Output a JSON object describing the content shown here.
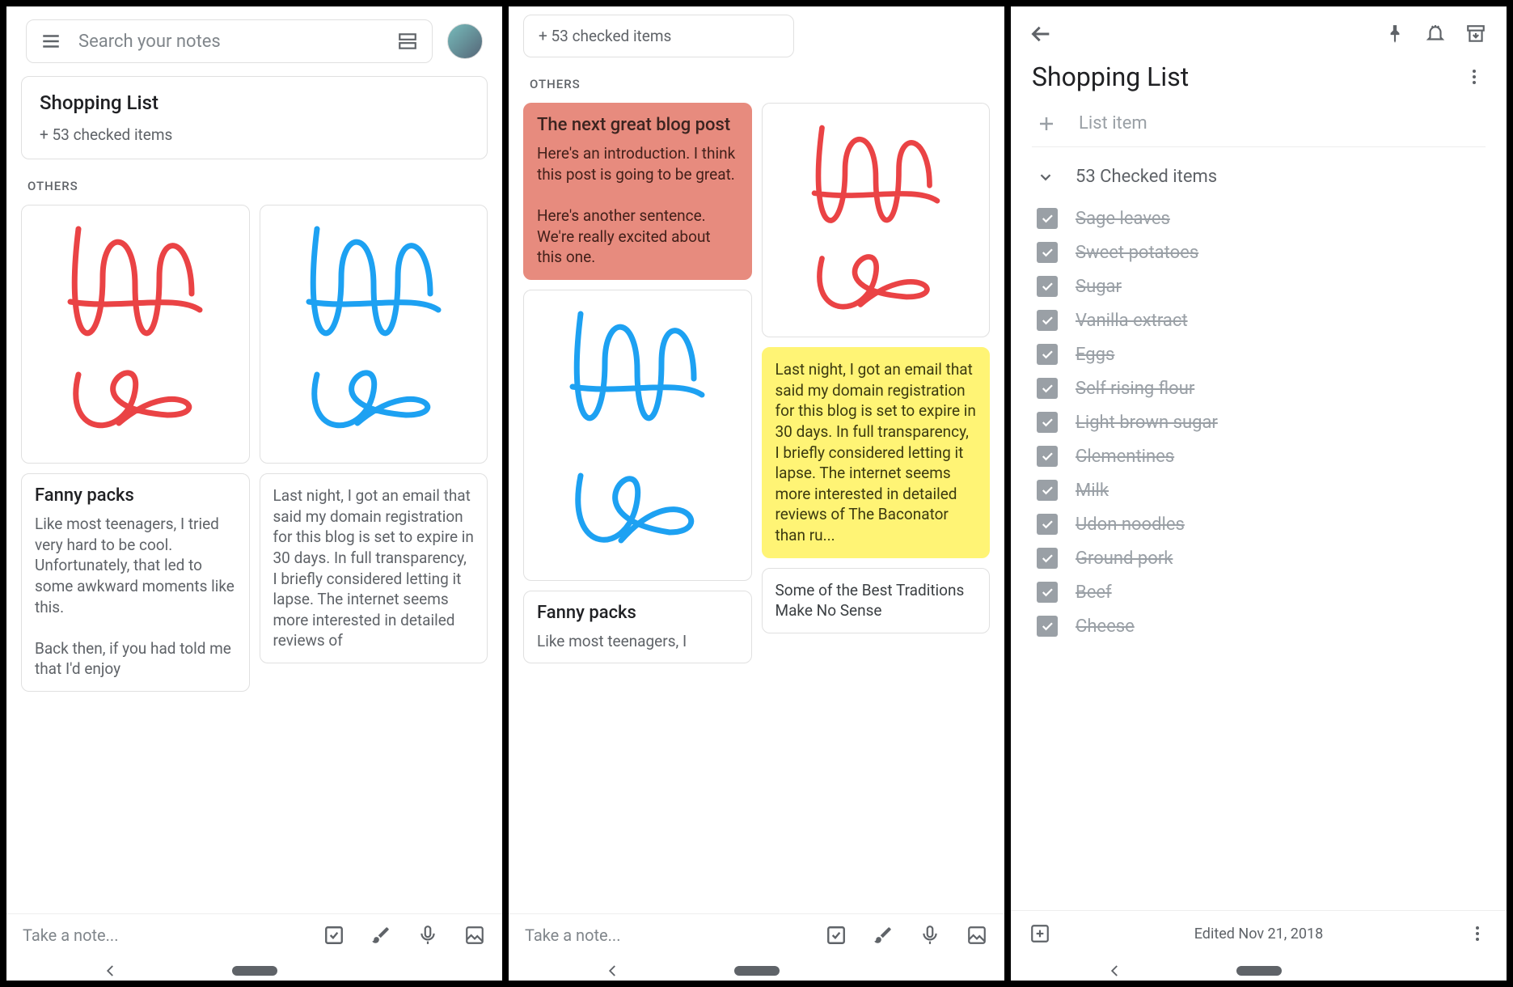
{
  "panel1": {
    "search_placeholder": "Search your notes",
    "pinned": {
      "title": "Shopping List",
      "subtitle": "+ 53 checked items"
    },
    "section_label": "OTHERS",
    "col1": [
      {
        "type": "drawing",
        "color": "red"
      },
      {
        "type": "text",
        "title": "Fanny packs",
        "body": "Like most teenagers, I tried very hard to be cool. Unfortunately, that led to some awkward moments like this.\n\nBack then, if you had told me that I'd enjoy"
      }
    ],
    "col2": [
      {
        "type": "drawing",
        "color": "blue"
      },
      {
        "type": "text",
        "body": "Last night, I got an email that said my domain registration for this blog is set to expire in 30 days. In full transparency, I briefly considered letting it lapse. The internet seems more interested in detailed reviews of"
      }
    ],
    "take_note": "Take a note..."
  },
  "panel2": {
    "pinned_sub": "+ 53 checked items",
    "section_label": "OTHERS",
    "col1": [
      {
        "type": "text",
        "bg": "red",
        "title": "The next great blog post",
        "body": "Here's an introduction. I think this post is going to be great.\n\nHere's another sentence. We're really excited about this one."
      },
      {
        "type": "drawing",
        "color": "blue",
        "tall": true
      },
      {
        "type": "text",
        "title": "Fanny packs",
        "body": "Like most teenagers, I"
      }
    ],
    "col2": [
      {
        "type": "drawing",
        "color": "red"
      },
      {
        "type": "text",
        "bg": "yellow",
        "body": "Last night, I got an email that said my domain registration for this blog is set to expire in 30 days. In full transparency, I briefly considered letting it lapse. The internet seems more interested in detailed reviews of The Baconator than ru..."
      },
      {
        "type": "text",
        "body": "Some of the Best Traditions Make No Sense"
      }
    ],
    "take_note": "Take a note..."
  },
  "panel3": {
    "title": "Shopping List",
    "add_item": "List item",
    "checked_header": "53 Checked items",
    "items": [
      "Sage leaves",
      "Sweet potatoes",
      "Sugar",
      "Vanilla extract",
      "Eggs",
      "Self rising flour",
      "Light brown sugar",
      "Clementines",
      "Milk",
      "Udon noodles",
      "Ground pork",
      "Beef",
      "Cheese"
    ],
    "edited": "Edited Nov 21, 2018"
  }
}
